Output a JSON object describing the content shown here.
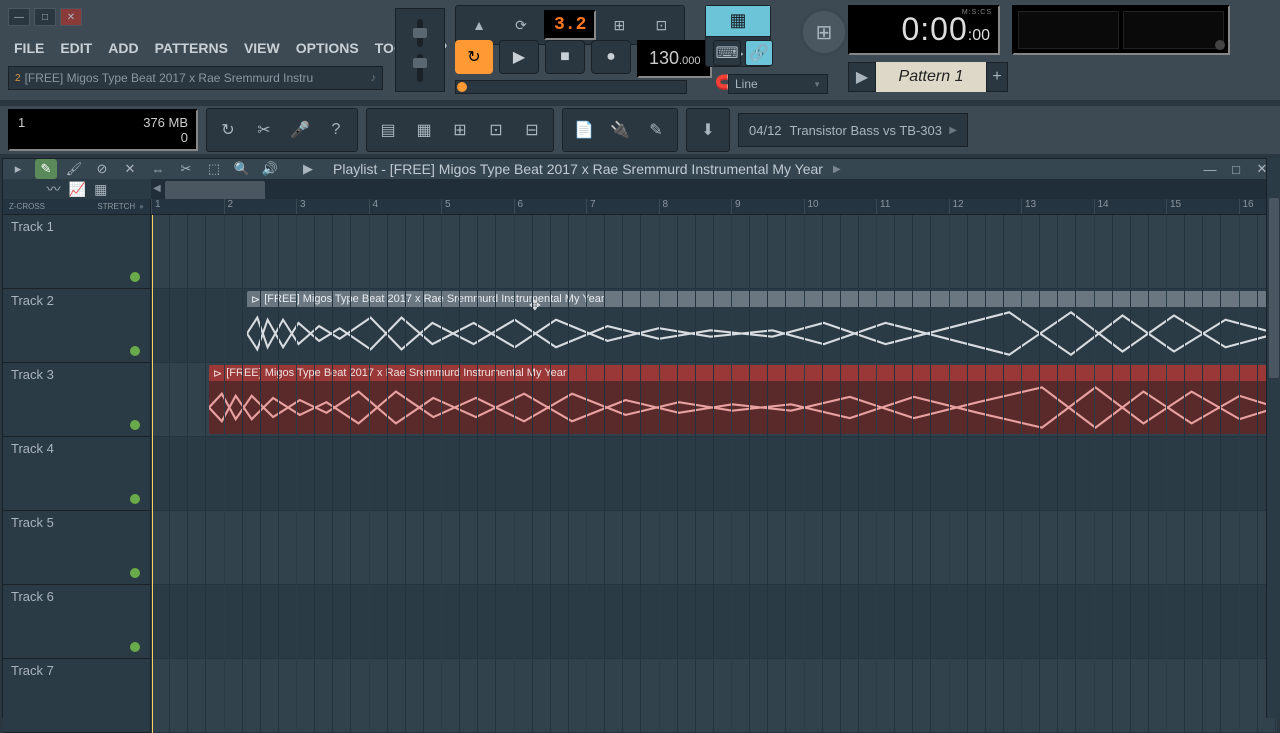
{
  "menu": {
    "file": "FILE",
    "edit": "EDIT",
    "add": "ADD",
    "patterns": "PATTERNS",
    "view": "VIEW",
    "options": "OPTIONS",
    "tools": "TOOLS",
    "help": "?"
  },
  "hint": {
    "num": "2",
    "text": "[FREE] Migos Type Beat 2017 x Rae Sremmurd Instru"
  },
  "time_sig": "3.2",
  "tempo": {
    "main": "130",
    "frac": ".000"
  },
  "snap": {
    "label": "Line"
  },
  "time": {
    "main": "0:00",
    "frac": ":00",
    "label": "M:S:CS"
  },
  "pattern": {
    "name": "Pattern 1"
  },
  "cpu": {
    "poly": "1",
    "mem": "376 MB",
    "zero": "0"
  },
  "news": {
    "id": "04/12",
    "text": "Transistor Bass vs TB-303"
  },
  "playlist": {
    "title": "Playlist - [FREE] Migos Type Beat 2017 x Rae Sremmurd Instrumental  My Year",
    "mini": {
      "zcross": "Z-CROSS",
      "stretch": "STRETCH"
    },
    "tracks": [
      "Track 1",
      "Track 2",
      "Track 3",
      "Track 4",
      "Track 5",
      "Track 6",
      "Track 7"
    ],
    "bars": [
      "1",
      "2",
      "3",
      "4",
      "5",
      "6",
      "7",
      "8",
      "9",
      "10",
      "11",
      "12",
      "13",
      "14",
      "15",
      "16"
    ],
    "clips": {
      "gray": {
        "label": "[FREE] Migos Type Beat 2017 x Rae Sremmurd Instrumental  My Year"
      },
      "red": {
        "label": "[FREE] Migos Type Beat 2017 x Rae Sremmurd Instrumental  My Year"
      }
    }
  }
}
